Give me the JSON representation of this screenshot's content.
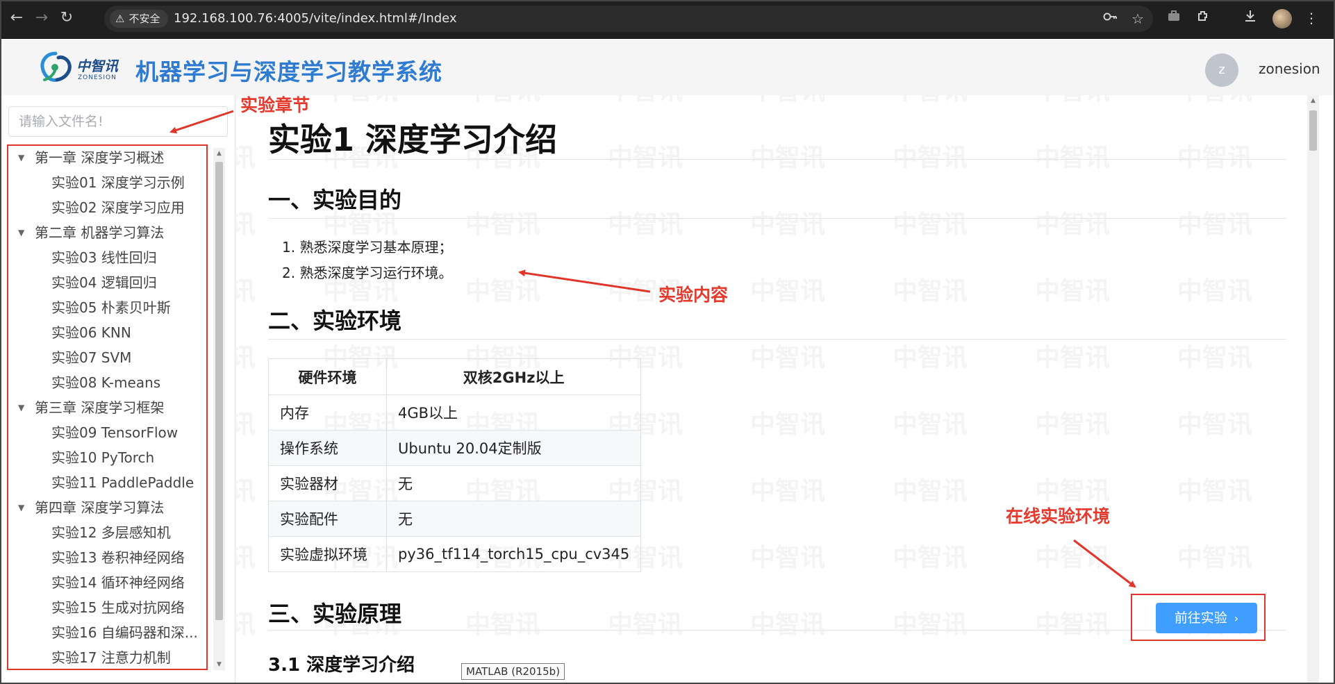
{
  "browser": {
    "security_label": "不安全",
    "url": "192.168.100.76:4005/vite/index.html#/Index"
  },
  "header": {
    "logo_cn": "中智讯",
    "logo_en": "ZONESION",
    "title": "机器学习与深度学习教学系统",
    "avatar_letter": "z",
    "username": "zonesion"
  },
  "sidebar": {
    "search_placeholder": "请输入文件名!",
    "tree": [
      {
        "label": "第一章 深度学习概述",
        "children": [
          "实验01 深度学习示例",
          "实验02 深度学习应用"
        ]
      },
      {
        "label": "第二章 机器学习算法",
        "children": [
          "实验03 线性回归",
          "实验04 逻辑回归",
          "实验05 朴素贝叶斯",
          "实验06 KNN",
          "实验07 SVM",
          "实验08 K-means"
        ]
      },
      {
        "label": "第三章 深度学习框架",
        "children": [
          "实验09 TensorFlow",
          "实验10 PyTorch",
          "实验11 PaddlePaddle"
        ]
      },
      {
        "label": "第四章 深度学习算法",
        "children": [
          "实验12 多层感知机",
          "实验13 卷积神经网络",
          "实验14 循环神经网络",
          "实验15 生成对抗网络",
          "实验16 自编码器和深...",
          "实验17 注意力机制"
        ]
      }
    ]
  },
  "content": {
    "title": "实验1 深度学习介绍",
    "section1": "一、实验目的",
    "objectives": [
      "1. 熟悉深度学习基本原理；",
      "2. 熟悉深度学习运行环境。"
    ],
    "section2": "二、实验环境",
    "env_table": {
      "headers": [
        "硬件环境",
        "双核2GHz以上"
      ],
      "rows": [
        [
          "内存",
          "4GB以上"
        ],
        [
          "操作系统",
          "Ubuntu 20.04定制版"
        ],
        [
          "实验器材",
          "无"
        ],
        [
          "实验配件",
          "无"
        ],
        [
          "实验虚拟环境",
          "py36_tf114_torch15_cpu_cv345"
        ]
      ]
    },
    "section3": "三、实验原理",
    "subsection31": "3.1 深度学习介绍",
    "go_button": "前往实验",
    "tooltip": "MATLAB (R2015b)",
    "watermark": "中智讯"
  },
  "annotations": {
    "chapters": "实验章节",
    "content": "实验内容",
    "online_env": "在线实验环境"
  },
  "colors": {
    "brand_blue": "#2f7bd1",
    "button_blue": "#409eff",
    "annotation_red": "#e0352b"
  }
}
